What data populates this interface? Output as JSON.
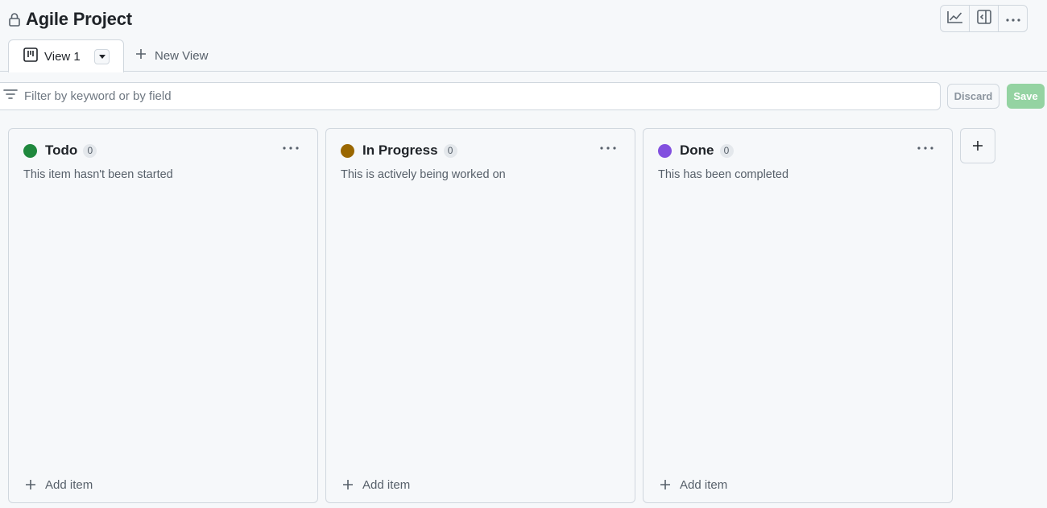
{
  "header": {
    "title": "Agile Project",
    "actions": [
      {
        "name": "insights",
        "icon": "graph-icon"
      },
      {
        "name": "side-panel",
        "icon": "sidebar-collapse-icon"
      },
      {
        "name": "more",
        "icon": "kebab-horizontal-icon"
      }
    ]
  },
  "tabs": {
    "active_label": "View 1",
    "new_view_label": "New View"
  },
  "filter": {
    "placeholder": "Filter by keyword or by field",
    "value": "",
    "discard_label": "Discard",
    "save_label": "Save"
  },
  "columns": [
    {
      "title": "Todo",
      "count": "0",
      "color": "#1f883d",
      "description": "This item hasn't been started",
      "add_label": "Add item"
    },
    {
      "title": "In Progress",
      "count": "0",
      "color": "#9a6700",
      "description": "This is actively being worked on",
      "add_label": "Add item"
    },
    {
      "title": "Done",
      "count": "0",
      "color": "#8250df",
      "description": "This has been completed",
      "add_label": "Add item"
    }
  ]
}
